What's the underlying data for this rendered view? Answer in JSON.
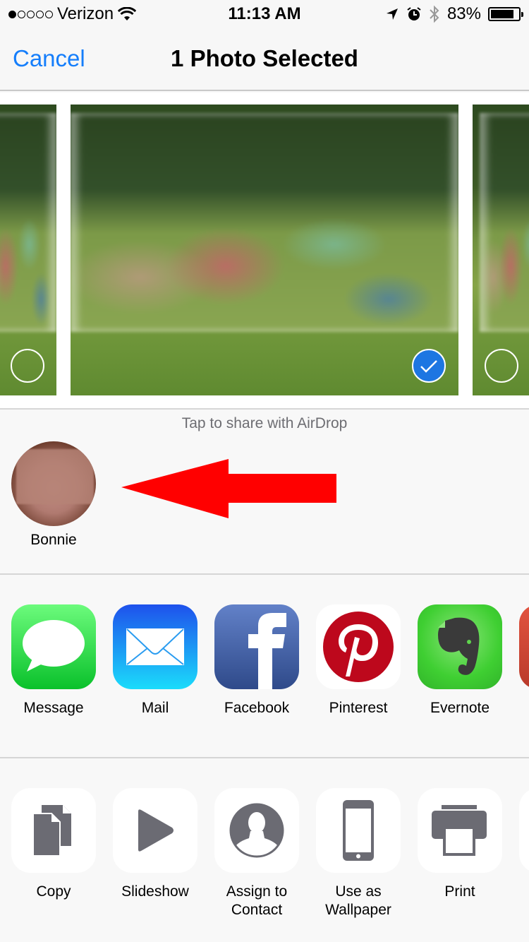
{
  "status_bar": {
    "carrier": "Verizon",
    "signal_bars_filled": 1,
    "signal_bars_total": 5,
    "time": "11:13 AM",
    "battery_percent": "83%",
    "battery_level": 0.83,
    "icons": [
      "wifi-icon",
      "location-icon",
      "alarm-icon",
      "bluetooth-icon",
      "battery-icon"
    ]
  },
  "nav": {
    "cancel_label": "Cancel",
    "title": "1 Photo Selected",
    "accent_color": "#157efb"
  },
  "photos": [
    {
      "position": "left",
      "selected": false
    },
    {
      "position": "center",
      "selected": true
    },
    {
      "position": "right",
      "selected": false
    }
  ],
  "airdrop": {
    "hint": "Tap to share with AirDrop",
    "people": [
      {
        "name": "Bonnie"
      }
    ],
    "annotation": "red-arrow pointing to contact"
  },
  "share_apps": [
    {
      "label": "Message",
      "icon": "message-icon"
    },
    {
      "label": "Mail",
      "icon": "mail-icon"
    },
    {
      "label": "Facebook",
      "icon": "facebook-icon"
    },
    {
      "label": "Pinterest",
      "icon": "pinterest-icon"
    },
    {
      "label": "Evernote",
      "icon": "evernote-icon"
    }
  ],
  "actions": [
    {
      "label": "Copy",
      "icon": "copy-icon"
    },
    {
      "label": "Slideshow",
      "icon": "play-icon"
    },
    {
      "label": "Assign to\nContact",
      "icon": "contact-icon"
    },
    {
      "label": "Use as\nWallpaper",
      "icon": "phone-icon"
    },
    {
      "label": "Print",
      "icon": "printer-icon"
    }
  ]
}
